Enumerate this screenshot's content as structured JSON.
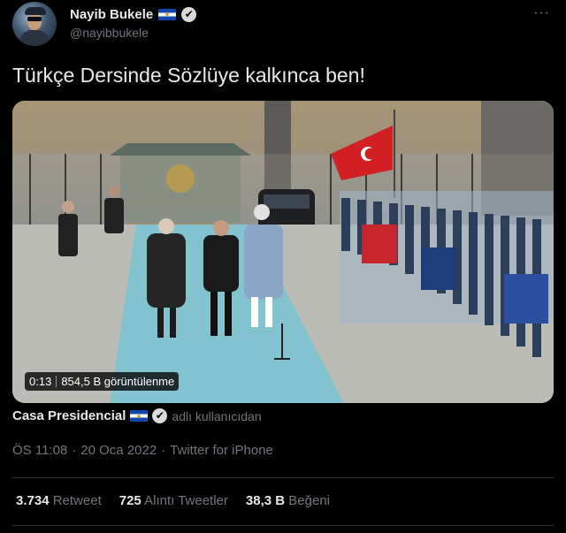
{
  "author": {
    "display_name": "Nayib Bukele",
    "handle": "@nayibbukele",
    "avatar_icon": "profile-photo-icon",
    "flag_icon": "el-salvador-flag-icon",
    "verified_icon": "verified-badge-icon",
    "verified_glyph": "✔"
  },
  "menu": {
    "more_glyph": "···"
  },
  "tweet": {
    "text": "Türkçe Dersinde Sözlüye kalkınca ben!"
  },
  "video": {
    "duration": "0:13",
    "views": "854,5 B görüntülenme",
    "thumbnail_icon": "video-thumbnail"
  },
  "source": {
    "account": "Casa Presidencial",
    "suffix": "adlı kullanıcıdan"
  },
  "meta": {
    "time": "ÖS 11:08",
    "dot": "·",
    "date": "20 Oca 2022",
    "client": "Twitter for iPhone"
  },
  "stats": [
    {
      "value": "3.734",
      "label": "Retweet"
    },
    {
      "value": "725",
      "label": "Alıntı Tweetler"
    },
    {
      "value": "38,3 B",
      "label": "Beğeni"
    }
  ],
  "colors": {
    "background": "#000000",
    "text_primary": "#e7e9ea",
    "text_secondary": "#71767b",
    "divider": "#2f3336"
  }
}
